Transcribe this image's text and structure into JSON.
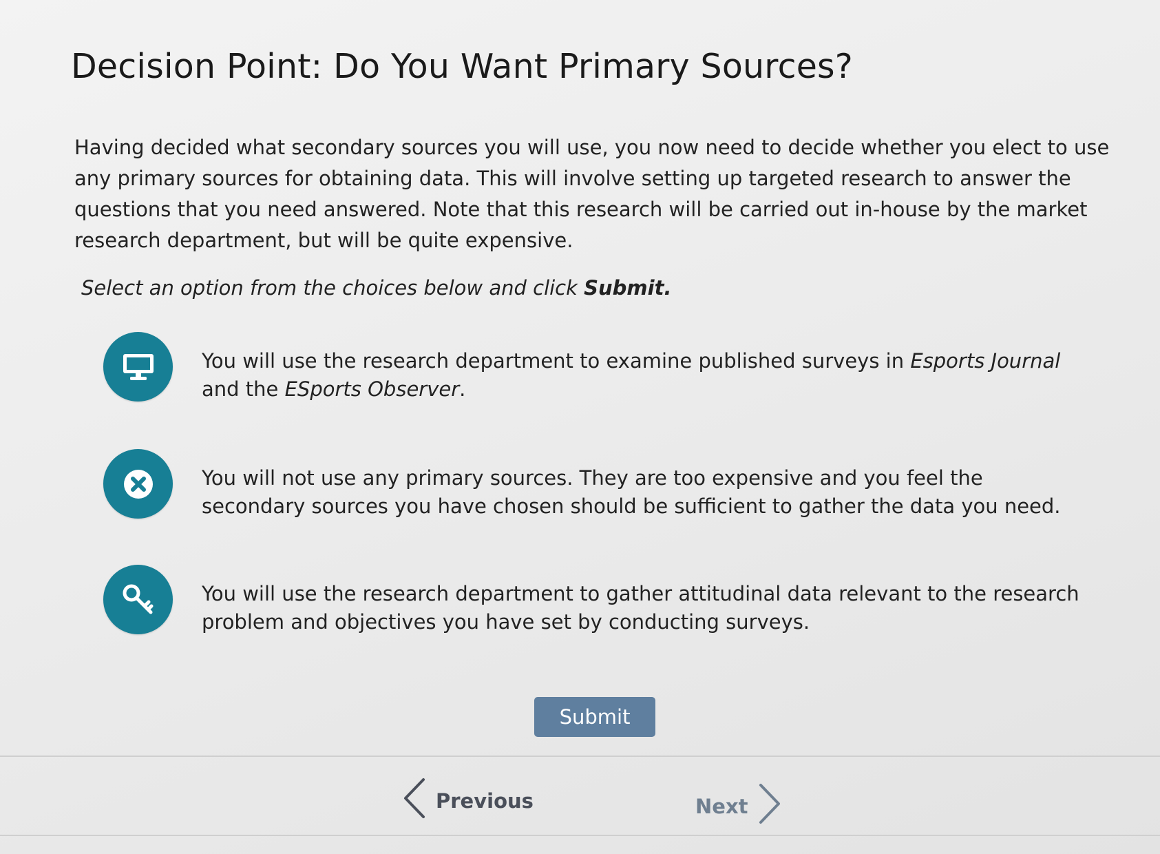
{
  "title": "Decision Point: Do You Want Primary Sources?",
  "intro": "Having decided what secondary sources you will use, you now need to decide whether you elect to use any primary sources for obtaining data. This will involve setting up targeted research to answer the questions that you need answered. Note that this research will be carried out in-house by the market research department, but will be quite expensive.",
  "instruction": {
    "prefix": "Select an option from the choices below and click ",
    "emphasis": "Submit."
  },
  "options": [
    {
      "icon": "monitor-icon",
      "text_before": "You will use the research department to examine published surveys in ",
      "journal1": "Esports Journal",
      "text_middle": " and the ",
      "journal2": "ESports Observer",
      "text_after": "."
    },
    {
      "icon": "close-circle-icon",
      "text": "You will not use any primary sources. They are too expensive and you feel the secondary sources you have chosen should be sufficient to gather the data you need."
    },
    {
      "icon": "key-icon",
      "text": "You will use the research department to gather attitudinal data relevant to the research problem and objectives you have set by conducting surveys."
    }
  ],
  "submit_label": "Submit",
  "nav": {
    "previous": "Previous",
    "next": "Next"
  },
  "colors": {
    "icon_bg": "#177f95",
    "submit_bg": "#5f7f9f"
  }
}
